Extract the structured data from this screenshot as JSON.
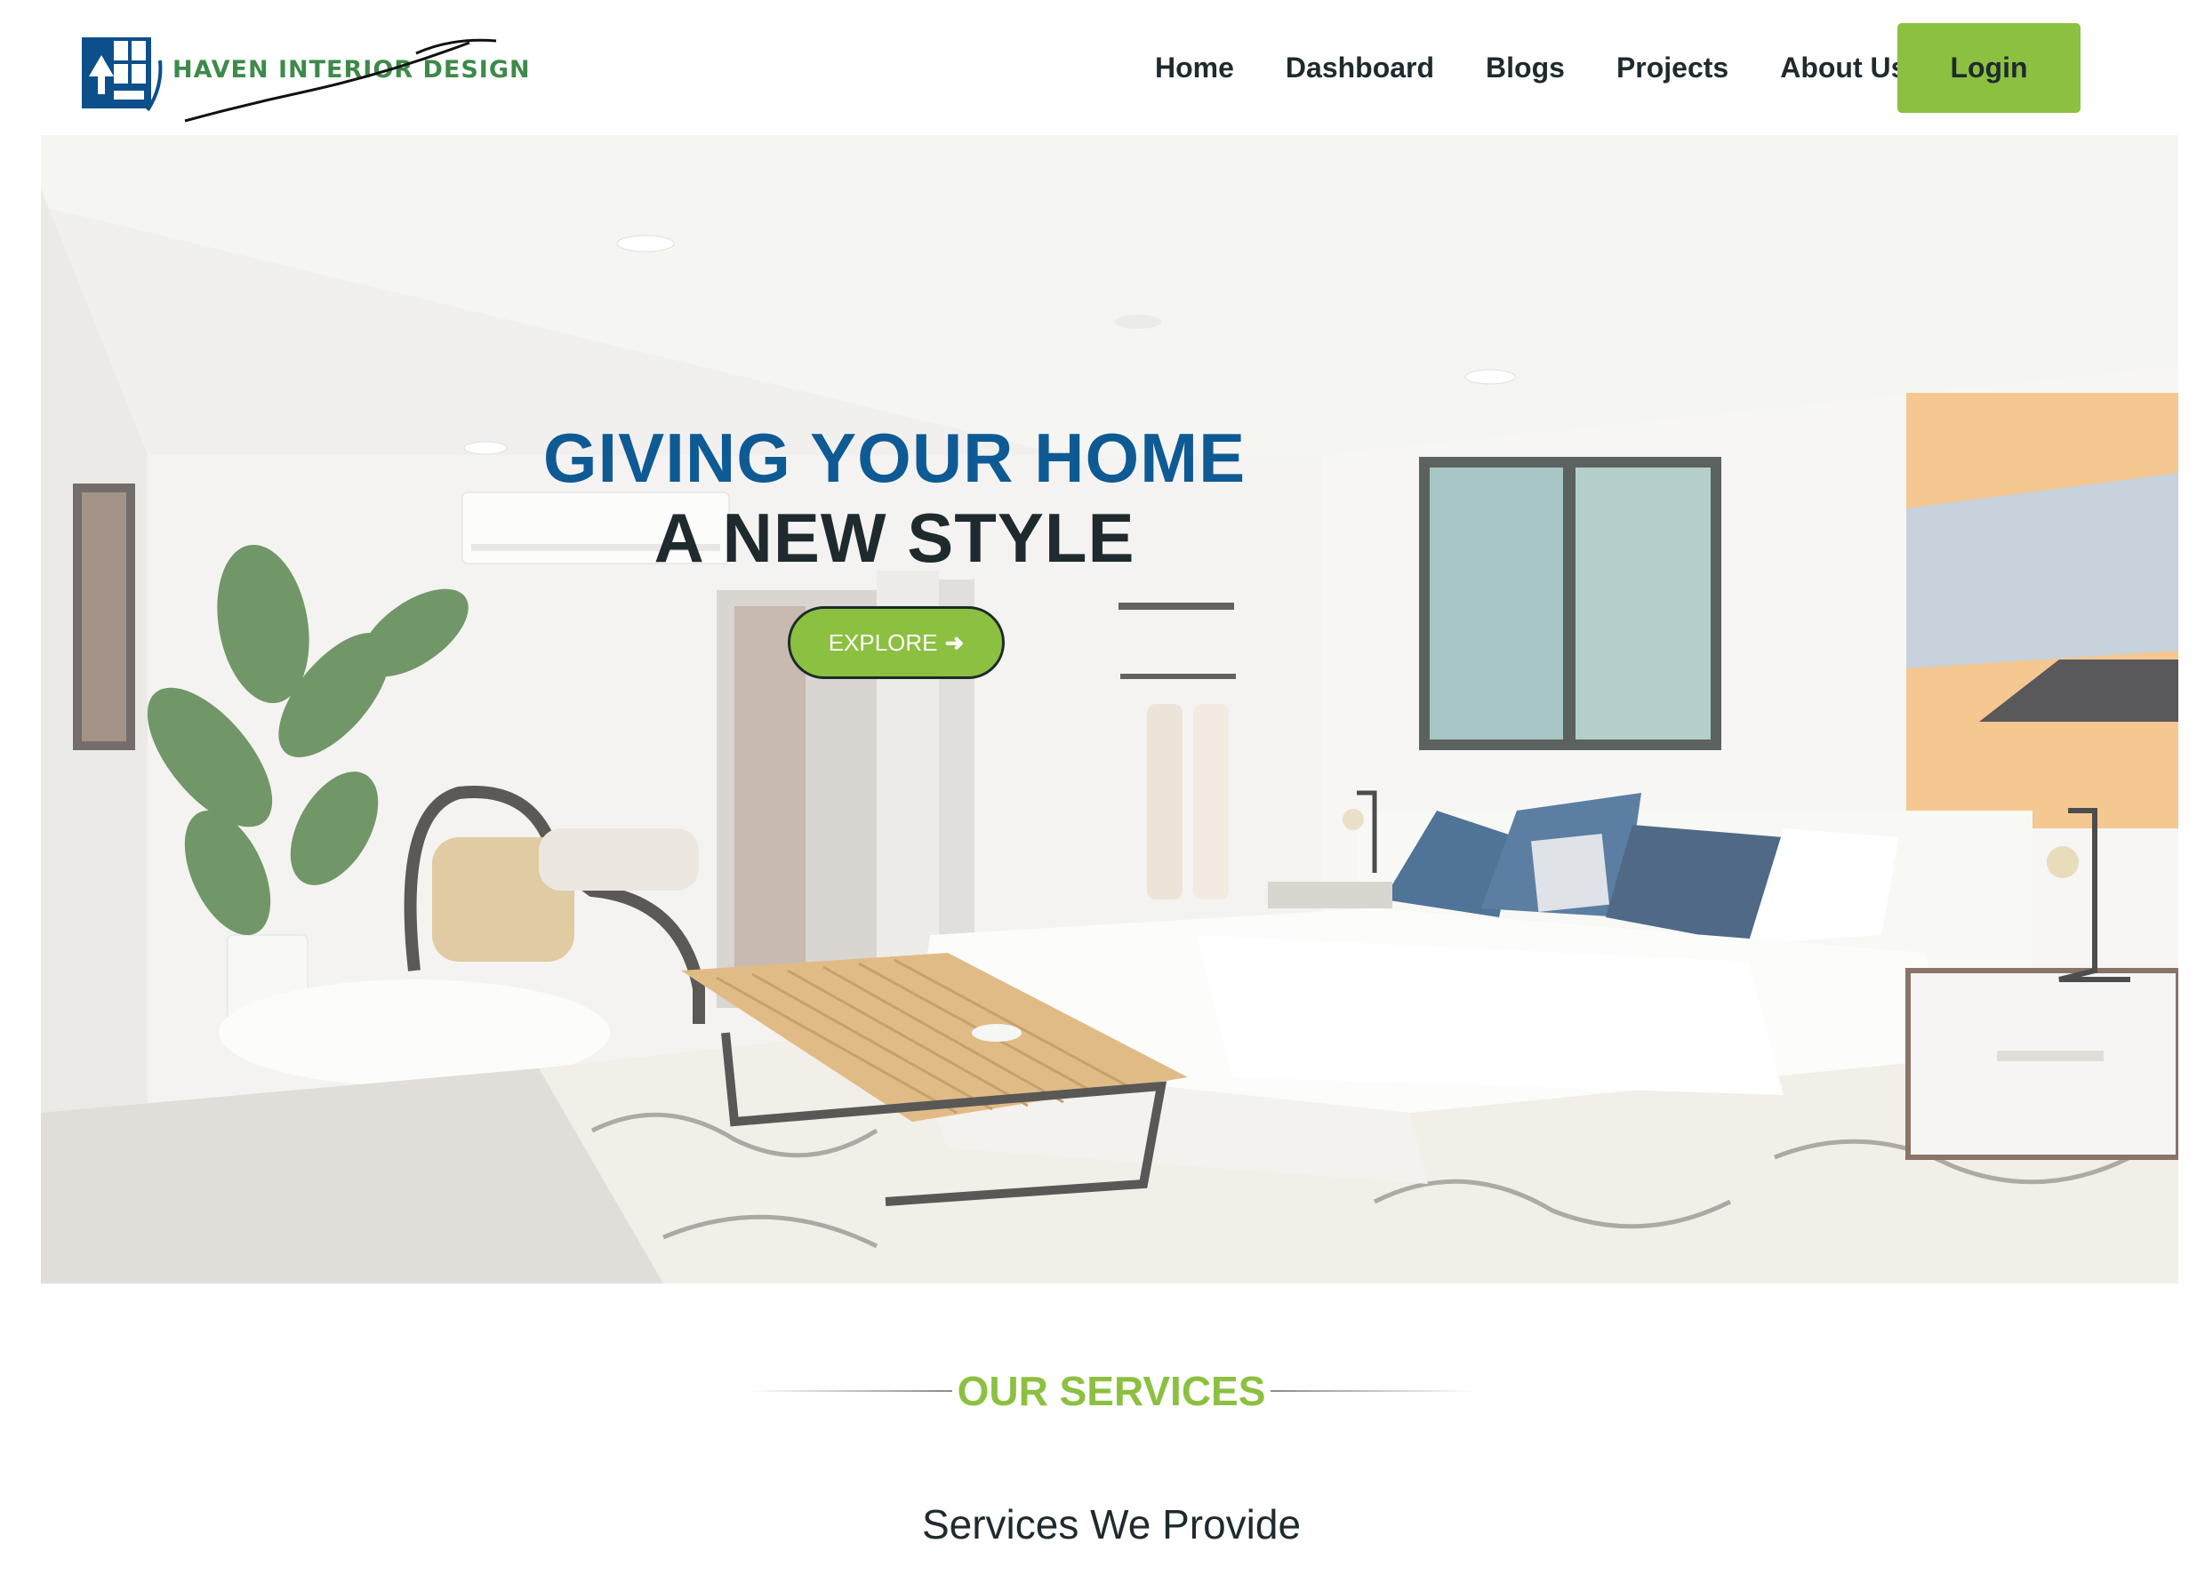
{
  "brand": {
    "name": "HAVEN INTERIOR DESIGN",
    "logo_icon": "house-window-icon"
  },
  "nav": {
    "items": [
      {
        "label": "Home"
      },
      {
        "label": "Dashboard"
      },
      {
        "label": "Blogs"
      },
      {
        "label": "Projects"
      },
      {
        "label": "About Us"
      }
    ],
    "login_label": "Login"
  },
  "hero": {
    "title_line1": "GIVING YOUR HOME",
    "title_line2": "A NEW STYLE",
    "cta_label": "EXPLORE",
    "cta_icon": "arrow-right-icon"
  },
  "services": {
    "eyebrow": "OUR SERVICES",
    "heading": "Services We Provide"
  },
  "colors": {
    "accent_green": "#8cc040",
    "brand_blue": "#0e5a94",
    "text_dark": "#1f2a2e"
  }
}
